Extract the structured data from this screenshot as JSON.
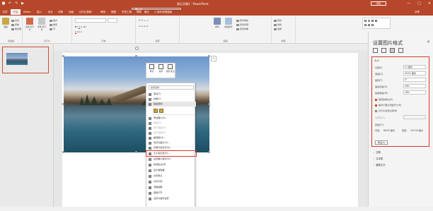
{
  "titlebar": {
    "title": "演示文稿1 - PowerPoint",
    "ctx_label": "图片工具",
    "account": "登录",
    "controls": [
      "—",
      "□",
      "×"
    ],
    "color": "#b7472a"
  },
  "tabs": [
    "文件",
    "开始",
    "Slides",
    "插入",
    "设计",
    "切换",
    "动画",
    "幻灯片放映",
    "审阅",
    "视图",
    "开发工具",
    "帮助",
    "格式"
  ],
  "tellme": "操作说明搜索",
  "share": "共享",
  "ribbon": {
    "groups": [
      "剪贴板",
      "幻灯片",
      "字体",
      "段落",
      "绘图",
      "编辑"
    ],
    "buttons": {
      "paste": "粘贴",
      "cut": "剪切",
      "copy": "复制",
      "format_painter": "格式刷",
      "new_slide": "新建\n幻灯片",
      "reuse_slide": "重用\n幻灯片",
      "layout": "版式",
      "reset": "重置",
      "section": "节",
      "arrange": "排列",
      "quick_styles": "快速样式",
      "shape_fill": "形状填充",
      "shape_outline": "形状轮廓",
      "shape_effects": "形状效果",
      "find": "查找",
      "replace": "替换",
      "select": "选择"
    },
    "font_size": "",
    "font_name": ""
  },
  "thumbs": {
    "slide_number": "1"
  },
  "notes_icon": "+",
  "minitoolbar": [
    "样式",
    "裁剪",
    "新建\n批注"
  ],
  "context_menu": {
    "search_placeholder": "搜索菜单",
    "items": [
      {
        "label": "剪切(T)",
        "dis": false
      },
      {
        "label": "复制(C)",
        "dis": false
      },
      {
        "label": "粘贴选项:",
        "dis": false
      },
      {
        "label": "更改图片(A)",
        "dis": false
      },
      {
        "label": "组合(G)",
        "dis": true
      },
      {
        "label": "置于顶层(R)",
        "dis": true
      },
      {
        "label": "置于底层(K)",
        "dis": true
      },
      {
        "label": "超链接(H)...",
        "dis": false
      },
      {
        "label": "另存为图片(S)...",
        "dis": false
      },
      {
        "label": "查看可选文字(A)...",
        "dis": false
      },
      {
        "label": "大小和位置(Z)...",
        "dis": false
      },
      {
        "label": "设置图片格式(O)...",
        "dis": false
      },
      {
        "label": "新建批注(M)",
        "dis": false
      },
      {
        "label": "显示编辑器",
        "dis": false
      },
      {
        "label": "共享笔记",
        "dis": false
      },
      {
        "label": "共享示例",
        "dis": false
      },
      {
        "label": "调整缩略",
        "dis": false
      },
      {
        "label": "链接打开",
        "dis": false
      },
      {
        "label": "设置为备用设置",
        "dis": false
      }
    ]
  },
  "pane": {
    "title": "设置图片格式",
    "close": "×",
    "size_section": "大小",
    "rows": [
      {
        "label": "高度(E)",
        "value": "11 厘米"
      },
      {
        "label": "宽度(D)",
        "value": "16.51 厘米"
      },
      {
        "label": "旋转(T)",
        "value": "0°"
      },
      {
        "label": "缩放高度(H)",
        "value": "16%"
      },
      {
        "label": "缩放宽度(W)",
        "value": "16%"
      }
    ],
    "checks": [
      {
        "label": "锁定纵横比(A)",
        "on": true
      },
      {
        "label": "相对于图片原始尺寸(R)",
        "on": true
      },
      {
        "label": "幻灯片最佳比例(B)",
        "on": false
      }
    ],
    "resolution_label": "分辨率(O)",
    "resolution_value": "",
    "original_size": "原始尺寸",
    "orig_h_label": "高度:",
    "orig_h": "66.83 厘米",
    "orig_w_label": "宽度:",
    "orig_w": "103.05 厘米",
    "reset": "重设(S)",
    "sections": [
      "位置",
      "文本框",
      "替换文字"
    ]
  },
  "colors": {
    "accent": "#b7472a",
    "highlight_box": "#d43a2a"
  }
}
